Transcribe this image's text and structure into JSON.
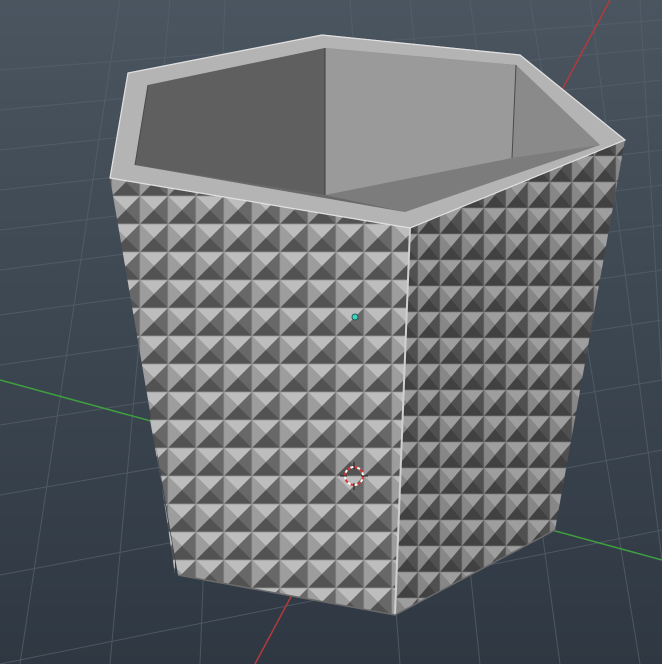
{
  "viewport": {
    "view": "perspective",
    "background_top": "#4a5560",
    "background_bottom": "#2f3842",
    "grid_color": "#55606b",
    "x_axis_color": "#b23a3a",
    "y_axis_color": "#3f9f3f"
  },
  "model": {
    "name_icon": "hexagonal-planter-mesh",
    "material_color": "#8f8f8f",
    "inner_wall_light": "#9a9a9a",
    "inner_wall_dark": "#606060",
    "rim_color": "#b4b4b4",
    "surface_pattern": "pyramid-studs"
  },
  "gizmos": {
    "pivot_color": "#3fd3c0",
    "cursor_3d_color": "#e03030"
  }
}
